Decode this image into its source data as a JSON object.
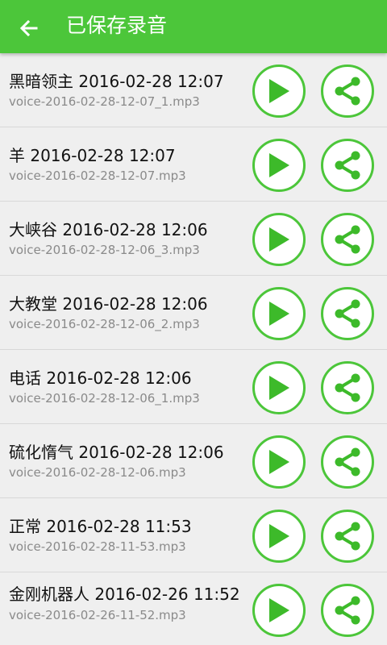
{
  "header": {
    "title": "已保存录音",
    "back_icon": "arrow-left-icon"
  },
  "colors": {
    "accent": "#4cc63a",
    "background": "#efefef",
    "filename": "#8a8a8a"
  },
  "recordings": [
    {
      "title": "黑暗领主 2016-02-28 12:07",
      "file": "voice-2016-02-28-12-07_1.mp3"
    },
    {
      "title": "羊 2016-02-28 12:07",
      "file": "voice-2016-02-28-12-07.mp3"
    },
    {
      "title": "大峡谷 2016-02-28 12:06",
      "file": "voice-2016-02-28-12-06_3.mp3"
    },
    {
      "title": "大教堂 2016-02-28 12:06",
      "file": "voice-2016-02-28-12-06_2.mp3"
    },
    {
      "title": "电话 2016-02-28 12:06",
      "file": "voice-2016-02-28-12-06_1.mp3"
    },
    {
      "title": "硫化惰气 2016-02-28 12:06",
      "file": "voice-2016-02-28-12-06.mp3"
    },
    {
      "title": "正常 2016-02-28 11:53",
      "file": "voice-2016-02-28-11-53.mp3"
    },
    {
      "title": "金刚机器人 2016-02-26 11:52",
      "file": "voice-2016-02-26-11-52.mp3"
    }
  ]
}
